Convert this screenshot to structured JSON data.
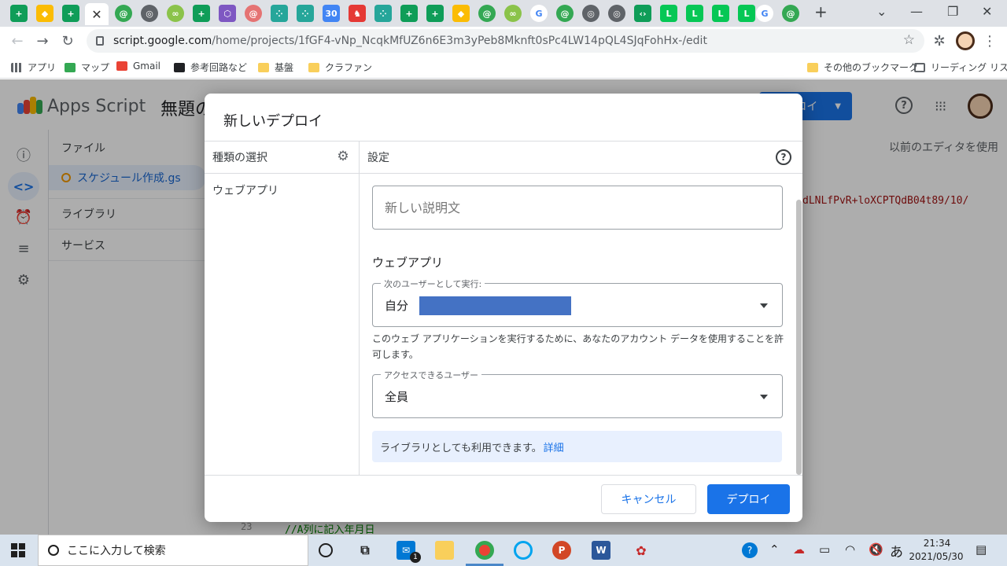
{
  "browser": {
    "address": {
      "host": "script.google.com",
      "path": "/home/projects/1fGF4-vNp_NcqkMfUZ6n6E3m3yPeb8Mknft0sPc4LW14pQL4SJqFohHx-/edit"
    },
    "bookmarks": {
      "apps": "アプリ",
      "maps": "マップ",
      "gmail": "Gmail",
      "route": "参考回路など",
      "kiban": "基盤",
      "crowdfunding": "クラファン",
      "other": "その他のブックマーク",
      "reading_list": "リーディング リスト"
    }
  },
  "app": {
    "brand": "Apps Script",
    "project_title": "無題の",
    "deploy_top": "ロイ",
    "old_editor": "以前のエディタを使用",
    "files_label": "ファイル",
    "file_name": "スケジュール作成.gs",
    "libraries_label": "ライブラリ",
    "services_label": "サービス",
    "code_fragment": "dLNLfPvR+loXCPTQdB04t89/10/",
    "line_number": "23",
    "line_code": "//A列に記入年月日"
  },
  "dialog": {
    "title": "新しいデプロイ",
    "type_header": "種類の選択",
    "type_webapp": "ウェブアプリ",
    "settings_header": "設定",
    "description_placeholder": "新しい説明文",
    "webapp_heading": "ウェブアプリ",
    "execute_as_label": "次のユーザーとして実行:",
    "execute_as_value": "自分",
    "execute_note": "このウェブ アプリケーションを実行するために、あなたのアカウント データを使用することを許可します。",
    "access_label": "アクセスできるユーザー",
    "access_value": "全員",
    "library_note": "ライブラリとしても利用できます。",
    "library_link": "詳細",
    "cancel": "キャンセル",
    "deploy": "デプロイ"
  },
  "taskbar": {
    "search_placeholder": "ここに入力して検索",
    "mail_badge": "1",
    "ime": "あ",
    "time": "21:34",
    "date": "2021/05/30"
  },
  "colors": {
    "accent": "#1a73e8",
    "redaction": "#4472c4",
    "info_banner": "#e8f0fe"
  }
}
